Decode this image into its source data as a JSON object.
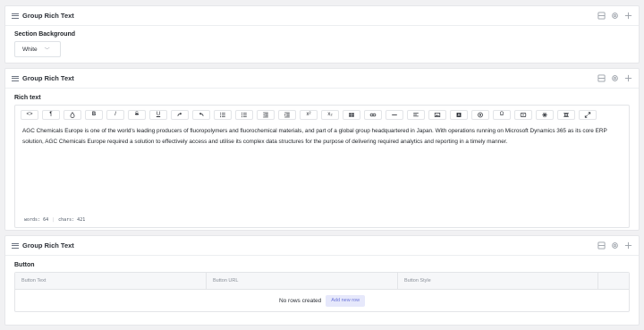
{
  "panel1": {
    "title": "Group Rich Text",
    "field_label": "Section Background",
    "select_value": "White"
  },
  "panel2": {
    "title": "Group Rich Text",
    "field_label": "Rich text",
    "content": "AGC Chemicals Europe is one of the world's leading producers of fluoropolymers and fluorochemical materials, and part of a global group headquartered in Japan. With operations running on Microsoft Dynamics 365 as its core ERP solution, AGC Chemicals Europe required a solution to effectively access and utilise its complex data structures for the purpose of delivering required analytics and reporting in a timely manner.",
    "words": "words: 64",
    "chars": "chars: 421",
    "toolbar": {
      "source": "<>",
      "paragraph": "¶",
      "bold": "B",
      "italic": "I",
      "strike": "S",
      "underline": "U",
      "superscript": "x²",
      "subscript": "x₂",
      "special_char": "Ω"
    }
  },
  "panel3": {
    "title": "Group Rich Text",
    "field_label": "Button",
    "columns": [
      "Button Text",
      "Button URL",
      "Button Style"
    ],
    "empty_text": "No rows created",
    "add_row_label": "Add new row"
  },
  "colors": {
    "background": "#f1f1f3",
    "panel": "#ffffff",
    "accent": "#6b74d9",
    "accent_bg": "#e6e8fb"
  }
}
